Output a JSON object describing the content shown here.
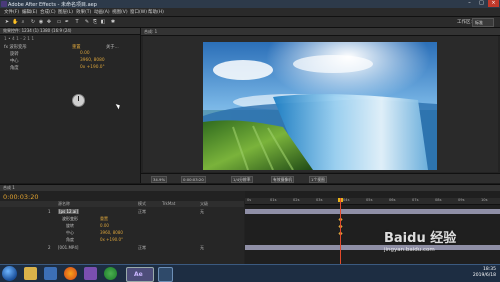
{
  "window": {
    "title": "Adobe After Effects - 未命名项目.aep"
  },
  "menu": [
    "文件(F)",
    "编辑(E)",
    "合成(C)",
    "图层(L)",
    "效果(T)",
    "动画(A)",
    "视图(V)",
    "窗口(W)",
    "帮助(H)"
  ],
  "toolbar": {
    "tools": [
      "select-tool-icon",
      "hand-tool-icon",
      "zoom-tool-icon",
      "rotate-tool-icon",
      "camera-tool-icon",
      "pan-behind-tool-icon",
      "mask-tool-icon",
      "pen-tool-icon",
      "text-tool-icon",
      "brush-tool-icon",
      "clone-tool-icon",
      "eraser-tool-icon",
      "puppet-tool-icon"
    ],
    "workspace_label": "工作区:",
    "workspace_value": "标准"
  },
  "effects_panel": {
    "tab_label": "效果控件: 1234 (1) 1380 (16:9 (24)",
    "layer_label": "1 • 4 1 - 2 1 1",
    "rows": [
      {
        "label": "fx 波形变形",
        "value": "重置",
        "extra": "关于..."
      },
      {
        "label": "旋转",
        "value": "0.00"
      },
      {
        "label": "中心",
        "value": "3960, 8080"
      },
      {
        "label": "角度",
        "value": "0x +190.0°"
      }
    ]
  },
  "comp_panel": {
    "tab_label": "合成: 1"
  },
  "comp_controls": {
    "zoom": "34.9%",
    "timecode": "0:00:03:20",
    "resolution": "1/4分辨率",
    "camera": "有效摄像机",
    "view": "1个视图"
  },
  "timeline": {
    "tab_label": "合成 1",
    "timecode": "0:00:03:20",
    "ruler_ticks": [
      "0s",
      "01s",
      "02s",
      "03s",
      "04s",
      "05s",
      "06s",
      "07s",
      "08s",
      "09s",
      "10s"
    ],
    "columns": {
      "source": "源名称",
      "mode": "模式",
      "trkmat": "TrkMat",
      "parent": "父级"
    },
    "layers": [
      {
        "index": "1",
        "name": "[ps 12.ai]",
        "mode": "正常",
        "parent": "无"
      },
      {
        "index": "",
        "name": "波形变形",
        "value": "重置"
      },
      {
        "index": "",
        "name": "旋转",
        "value": "0.00"
      },
      {
        "index": "",
        "name": "中心",
        "value": "3960, 8080"
      },
      {
        "index": "",
        "name": "角度",
        "value": "0x +190.0°"
      },
      {
        "index": "2",
        "name": "[001.MP4]",
        "mode": "正常",
        "parent": "无"
      }
    ]
  },
  "taskbar": {
    "apps": [
      "explorer-icon",
      "media-player-icon",
      "firefox-icon",
      "app-icon",
      "chrome-icon",
      "after-effects-icon",
      "photoshop-icon"
    ],
    "time": "18:35",
    "date": "2019/6/18"
  },
  "watermark": {
    "text": "Baidu 经验",
    "url": "jingyan.baidu.com"
  },
  "colors": {
    "accent": "#d9a33b",
    "playhead": "#e24a2b",
    "taskbar": "#1d2d42"
  }
}
